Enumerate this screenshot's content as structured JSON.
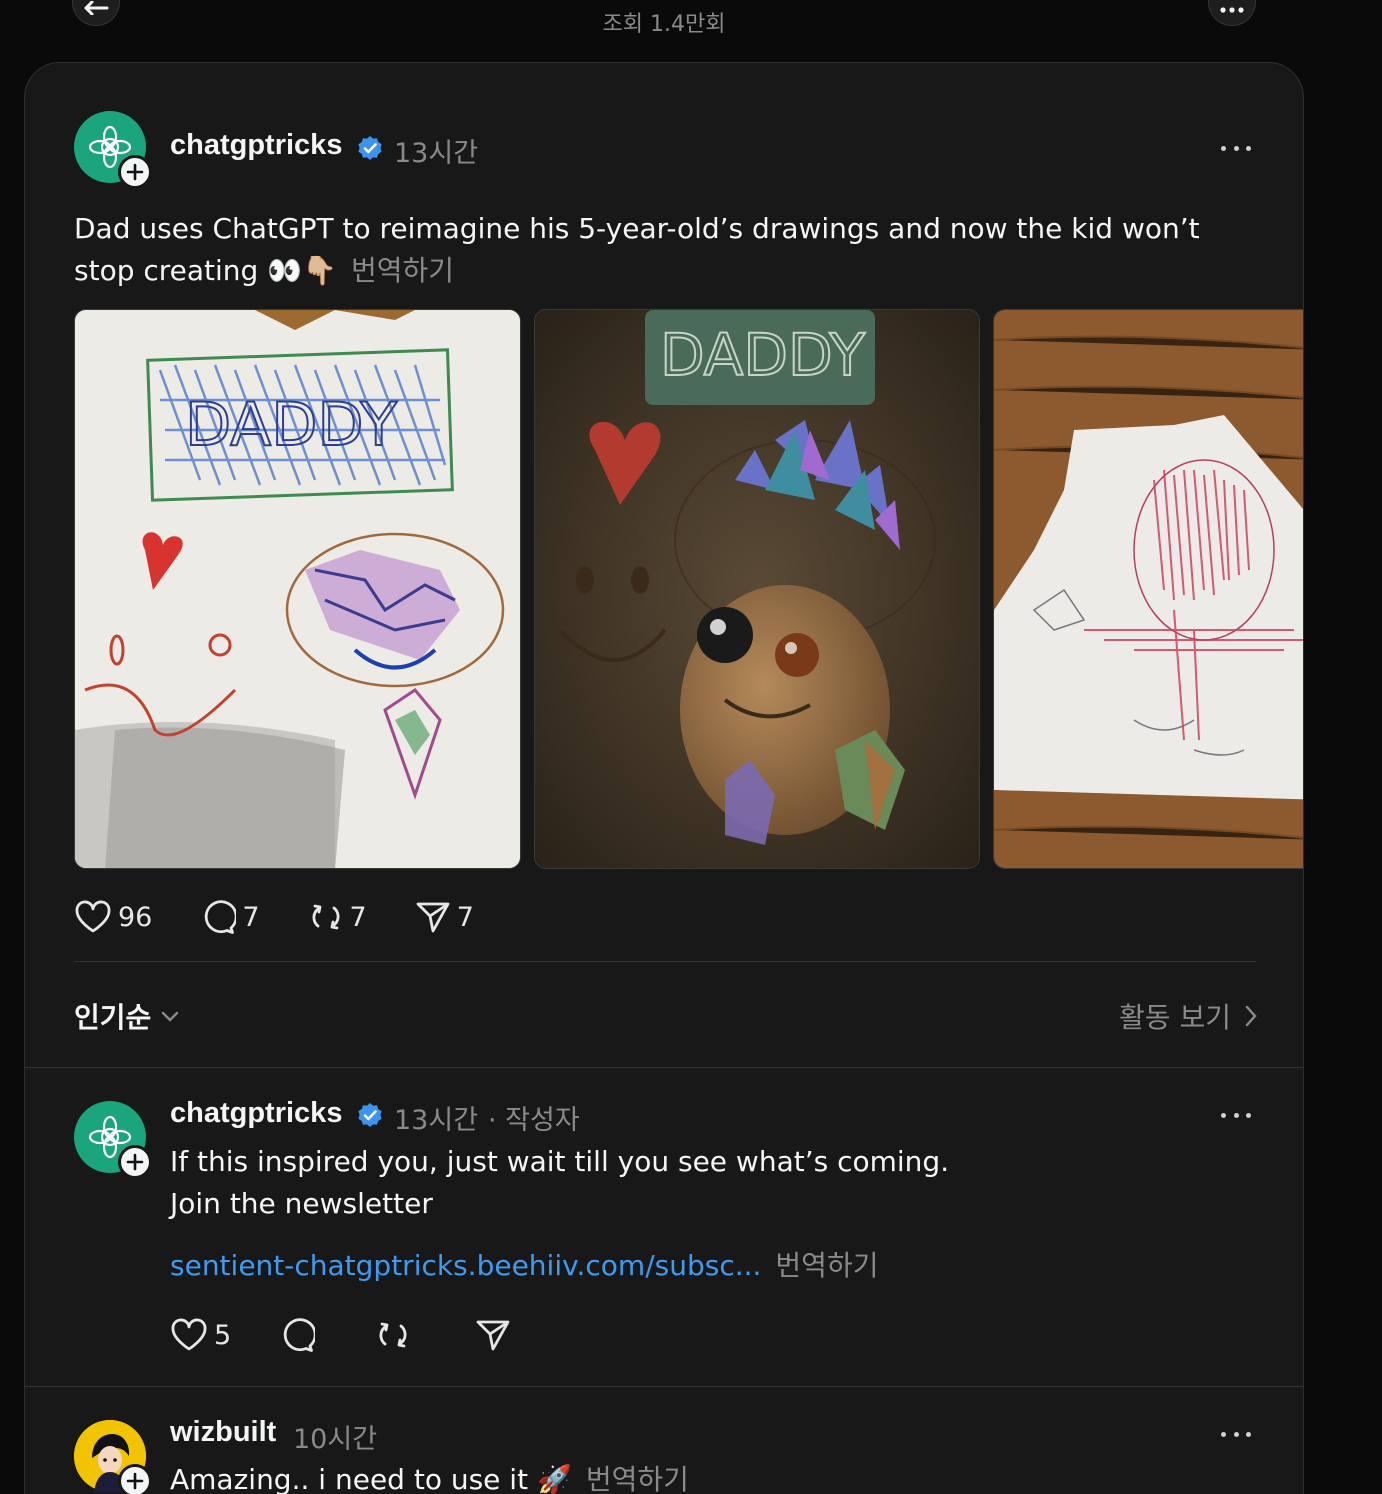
{
  "header": {
    "views": "조회 1.4만회"
  },
  "post": {
    "author": "chatgptricks",
    "time": "13시간",
    "text": "Dad uses ChatGPT to reimagine his 5-year-old’s drawings and now the kid won’t stop creating 👀👇🏼",
    "translate": "번역하기",
    "images": [
      {
        "title": "DADDY",
        "alt": "child crayon drawing with DADDY sign, heart, smiley face and gem"
      },
      {
        "title": "DADDY",
        "alt": "AI reimagined clay creature with crystal crown and DADDY sign"
      },
      {
        "alt": "child drawing of red scribbled figure on paper on wood table"
      }
    ],
    "likes": "96",
    "comments": "7",
    "reposts": "7",
    "shares": "7"
  },
  "sort": {
    "label": "인기순",
    "activity": "활동 보기"
  },
  "replies": [
    {
      "author": "chatgptricks",
      "time": "13시간",
      "role": "· 작성자",
      "line1": "If this inspired you, just wait till you see what’s coming.",
      "line2": "Join the newsletter",
      "link": "sentient-chatgptricks.beehiiv.com/subsc...",
      "translate": "번역하기",
      "likes": "5"
    },
    {
      "author": "wizbuilt",
      "time": "10시간",
      "text": "Amazing.. i need to use it 🚀",
      "translate": "번역하기"
    }
  ],
  "colors": {
    "background": "#0a0a0a",
    "panel": "#181818",
    "accent_link": "#3d9bf0",
    "verified": "#3b95f0",
    "avatar_green": "#1aa57d"
  }
}
